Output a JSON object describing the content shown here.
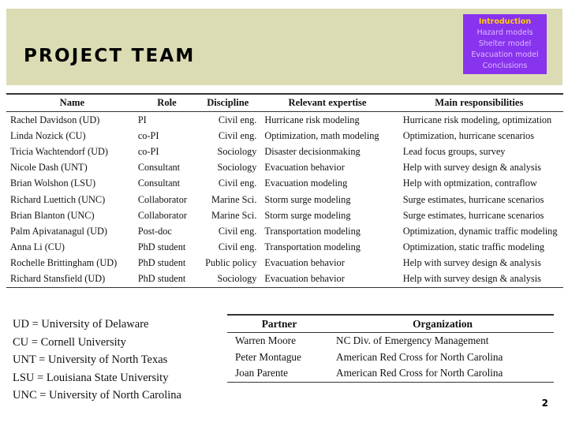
{
  "slide": {
    "title": "PROJECT TEAM",
    "page_number": "2",
    "header_bg": "#dcdcb4"
  },
  "nav": {
    "bg": "#8833ee",
    "active_color": "#ffcc00",
    "inactive_color": "#ddbbff",
    "items": [
      {
        "label": "Introduction",
        "active": true
      },
      {
        "label": "Hazard models",
        "active": false
      },
      {
        "label": "Shelter model",
        "active": false
      },
      {
        "label": "Evacuation model",
        "active": false
      },
      {
        "label": "Conclusions",
        "active": false
      }
    ]
  },
  "team_table": {
    "headers": [
      "Name",
      "Role",
      "Discipline",
      "Relevant expertise",
      "Main responsibilities"
    ],
    "rows": [
      {
        "name": "Rachel Davidson (UD)",
        "role": "PI",
        "discipline": "Civil eng.",
        "expertise": "Hurricane risk modeling",
        "responsibilities": "Hurricane risk modeling, optimization"
      },
      {
        "name": "Linda Nozick (CU)",
        "role": "co-PI",
        "discipline": "Civil eng.",
        "expertise": "Optimization, math modeling",
        "responsibilities": "Optimization, hurricane scenarios"
      },
      {
        "name": "Tricia Wachtendorf (UD)",
        "role": "co-PI",
        "discipline": "Sociology",
        "expertise": "Disaster decisionmaking",
        "responsibilities": "Lead focus groups, survey"
      },
      {
        "name": "Nicole Dash (UNT)",
        "role": "Consultant",
        "discipline": "Sociology",
        "expertise": "Evacuation behavior",
        "responsibilities": "Help with survey design & analysis"
      },
      {
        "name": "Brian Wolshon (LSU)",
        "role": "Consultant",
        "discipline": "Civil eng.",
        "expertise": "Evacuation modeling",
        "responsibilities": "Help with optmization, contraflow"
      },
      {
        "name": "Richard Luettich (UNC)",
        "role": "Collaborator",
        "discipline": "Marine Sci.",
        "expertise": "Storm surge modeling",
        "responsibilities": "Surge estimates, hurricane scenarios"
      },
      {
        "name": "Brian Blanton (UNC)",
        "role": "Collaborator",
        "discipline": "Marine Sci.",
        "expertise": "Storm surge modeling",
        "responsibilities": "Surge estimates, hurricane scenarios"
      },
      {
        "name": "Palm Apivatanagul (UD)",
        "role": "Post-doc",
        "discipline": "Civil eng.",
        "expertise": "Transportation modeling",
        "responsibilities": "Optimization, dynamic traffic modeling"
      },
      {
        "name": "Anna Li (CU)",
        "role": "PhD student",
        "discipline": "Civil eng.",
        "expertise": "Transportation modeling",
        "responsibilities": "Optimization, static traffic modeling"
      },
      {
        "name": "Rochelle Brittingham (UD)",
        "role": "PhD student",
        "discipline": "Public policy",
        "expertise": "Evacuation behavior",
        "responsibilities": "Help with survey design & analysis"
      },
      {
        "name": "Richard Stansfield (UD)",
        "role": "PhD student",
        "discipline": "Sociology",
        "expertise": "Evacuation behavior",
        "responsibilities": "Help with survey design & analysis"
      }
    ]
  },
  "legend": {
    "lines": [
      "UD = University of Delaware",
      "CU = Cornell University",
      "UNT = University of North Texas",
      "LSU = Louisiana State University",
      "UNC = University of North Carolina"
    ]
  },
  "partner_table": {
    "headers": [
      "Partner",
      "Organization"
    ],
    "rows": [
      {
        "partner": "Warren Moore",
        "organization": "NC Div. of Emergency Management"
      },
      {
        "partner": "Peter Montague",
        "organization": "American Red Cross for North Carolina"
      },
      {
        "partner": "Joan Parente",
        "organization": "American Red Cross for North Carolina"
      }
    ]
  }
}
